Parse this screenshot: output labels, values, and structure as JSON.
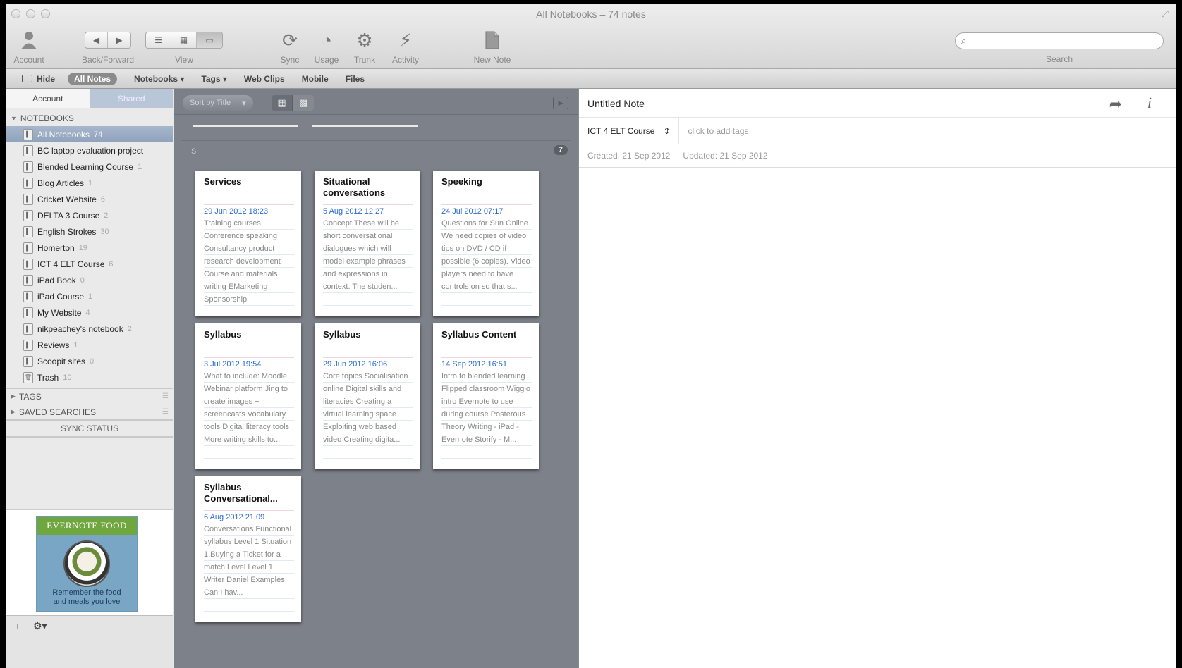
{
  "window": {
    "title": "All Notebooks – 74 notes"
  },
  "toolbar": {
    "account": "Account",
    "back_forward": "Back/Forward",
    "view": "View",
    "sync": "Sync",
    "usage": "Usage",
    "trunk": "Trunk",
    "activity": "Activity",
    "new_note": "New Note",
    "search_label": "Search",
    "search_value": ""
  },
  "navbar": {
    "hide": "Hide",
    "all_notes": "All Notes",
    "notebooks": "Notebooks ▾",
    "tags": "Tags ▾",
    "web_clips": "Web Clips",
    "mobile": "Mobile",
    "files": "Files"
  },
  "sidebar": {
    "tab_account": "Account",
    "tab_shared": "Shared",
    "notebooks_header": "NOTEBOOKS",
    "notebooks": [
      {
        "name": "All Notebooks",
        "count": "74"
      },
      {
        "name": "BC laptop evaluation project",
        "count": ""
      },
      {
        "name": "Blended Learning Course",
        "count": "1"
      },
      {
        "name": "Blog Articles",
        "count": "1"
      },
      {
        "name": "Cricket Website",
        "count": "6"
      },
      {
        "name": "DELTA 3 Course",
        "count": "2"
      },
      {
        "name": "English Strokes",
        "count": "30"
      },
      {
        "name": "Homerton",
        "count": "19"
      },
      {
        "name": "ICT 4 ELT Course",
        "count": "6"
      },
      {
        "name": "iPad Book",
        "count": "0"
      },
      {
        "name": "iPad Course",
        "count": "1"
      },
      {
        "name": "My Website",
        "count": "4"
      },
      {
        "name": "nikpeachey's notebook",
        "count": "2"
      },
      {
        "name": "Reviews",
        "count": "1"
      },
      {
        "name": "Scoopit sites",
        "count": "0"
      },
      {
        "name": "Trash",
        "count": "10"
      }
    ],
    "tags_header": "TAGS",
    "saved_searches_header": "SAVED SEARCHES",
    "sync_status": "SYNC STATUS",
    "promo": {
      "title": "EVERNOTE FOOD",
      "text_line1": "Remember the food",
      "text_line2": "and meals you love"
    },
    "footer_add": "+",
    "footer_gear": "⚙▾"
  },
  "notelist": {
    "sort_label": "Sort by Title",
    "group_label": "S",
    "group_count": "7",
    "cards": [
      {
        "title": "Services",
        "date": "29 Jun 2012 18:23",
        "snippet": "Training courses Conference speaking Consultancy product research development Course and materials writing EMarketing Sponsorship"
      },
      {
        "title": "Situational conversations",
        "date": "5 Aug 2012 12:27",
        "snippet": "Concept These will be short conversational dialogues which will model example phrases and expressions in context. The studen..."
      },
      {
        "title": "Speeking",
        "date": "24 Jul 2012 07:17",
        "snippet": "Questions for Sun Online We need copies of video tips on DVD / CD if possible (6 copies). Video players need to have controls on so that s..."
      },
      {
        "title": "Syllabus",
        "date": "3 Jul 2012 19:54",
        "snippet": "What to include: Moodle Webinar platform Jing to create images + screencasts Vocabulary tools Digital literacy tools More writing skills to..."
      },
      {
        "title": "Syllabus",
        "date": "29 Jun 2012 16:06",
        "snippet": "Core topics Socialisation online Digital skills and literacies Creating a virtual learning space Exploiting web based video Creating digita..."
      },
      {
        "title": "Syllabus Content",
        "date": "14 Sep 2012 16:51",
        "snippet": "Intro to blended learning Flipped classroom Wiggio intro Evernote to use during course Posterous Theory Writing - iPad - Evernote Storify - M..."
      },
      {
        "title": "Syllabus Conversational...",
        "date": "6 Aug 2012 21:09",
        "snippet": "Conversations Functional syllabus Level 1 Situation 1.Buying a Ticket for a match Level Level 1 Writer Daniel Examples Can I hav..."
      }
    ]
  },
  "editor": {
    "title": "Untitled Note",
    "notebook": "ICT 4 ELT Course",
    "tags_placeholder": "click to add tags",
    "created": "Created: 21 Sep 2012",
    "updated": "Updated: 21 Sep 2012"
  }
}
